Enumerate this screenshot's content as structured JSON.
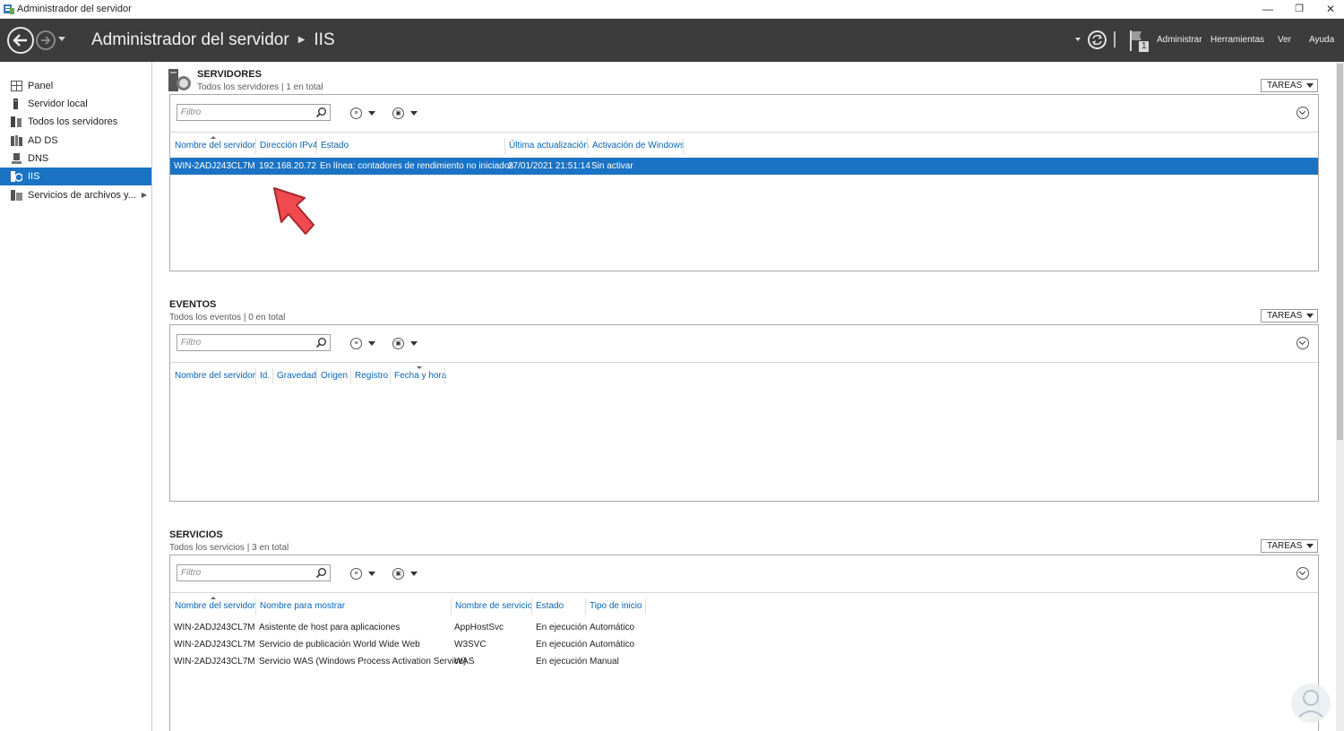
{
  "window": {
    "title": "Administrador del servidor",
    "minimize": "—",
    "restore": "❐",
    "close": "✕"
  },
  "header": {
    "breadcrumb_root": "Administrador del servidor",
    "breadcrumb_sep": "▶",
    "breadcrumb_current": "IIS",
    "notifications_count": "1",
    "menus": [
      "Administrar",
      "Herramientas",
      "Ver",
      "Ayuda"
    ]
  },
  "sidebar": {
    "items": [
      {
        "label": "Panel",
        "icon": "dashboard-icon"
      },
      {
        "label": "Servidor local",
        "icon": "local-server-icon"
      },
      {
        "label": "Todos los servidores",
        "icon": "all-servers-icon"
      },
      {
        "label": "AD DS",
        "icon": "ad-ds-icon"
      },
      {
        "label": "DNS",
        "icon": "dns-icon"
      },
      {
        "label": "IIS",
        "icon": "iis-icon",
        "selected": true
      },
      {
        "label": "Servicios de archivos y...",
        "icon": "file-services-icon",
        "has_submenu": true
      }
    ]
  },
  "servidores": {
    "title": "SERVIDORES",
    "subtitle": "Todos los servidores | 1 en total",
    "tareas": "TAREAS",
    "filter_placeholder": "Filtro",
    "columns": [
      "Nombre del servidor",
      "Dirección IPv4",
      "Estado",
      "Última actualización",
      "Activación de Windows"
    ],
    "rows": [
      [
        "WIN-2ADJ243CL7M",
        "192.168.20.72",
        "En línea: contadores de rendimiento no iniciados",
        "27/01/2021 21:51:14",
        "Sin activar"
      ]
    ]
  },
  "eventos": {
    "title": "EVENTOS",
    "subtitle": "Todos los eventos | 0 en total",
    "tareas": "TAREAS",
    "filter_placeholder": "Filtro",
    "columns": [
      "Nombre del servidor",
      "Id.",
      "Gravedad",
      "Origen",
      "Registro",
      "Fecha y hora"
    ]
  },
  "servicios": {
    "title": "SERVICIOS",
    "subtitle": "Todos los servicios | 3 en total",
    "tareas": "TAREAS",
    "filter_placeholder": "Filtro",
    "columns": [
      "Nombre del servidor",
      "Nombre para mostrar",
      "Nombre de servicio",
      "Estado",
      "Tipo de inicio"
    ],
    "rows": [
      [
        "WIN-2ADJ243CL7M",
        "Asistente de host para aplicaciones",
        "AppHostSvc",
        "En ejecución",
        "Automático"
      ],
      [
        "WIN-2ADJ243CL7M",
        "Servicio de publicación World Wide Web",
        "W3SVC",
        "En ejecución",
        "Automático"
      ],
      [
        "WIN-2ADJ243CL7M",
        "Servicio WAS (Windows Process Activation Service)",
        "WAS",
        "En ejecución",
        "Manual"
      ]
    ]
  },
  "colors": {
    "header_bg": "#3c3c3c",
    "selection": "#1a73c4",
    "link": "#0a64b4",
    "annotation_arrow": "#f04a4f"
  }
}
